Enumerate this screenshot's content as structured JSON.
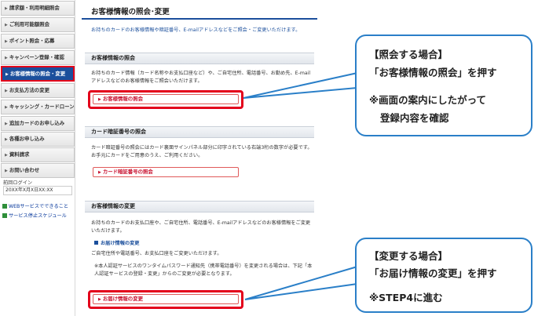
{
  "sidebar": {
    "items": [
      {
        "label": "請求額・利用明細照会"
      },
      {
        "label": "ご利用可能額照会"
      },
      {
        "label": "ポイント照会・応募"
      },
      {
        "label": "キャンペーン登録・確認"
      },
      {
        "label": "お客様情報の照会・変更"
      },
      {
        "label": "お支払方法の変更"
      },
      {
        "label": "キャッシング・カードローン"
      },
      {
        "label": "追加カードのお申し込み"
      },
      {
        "label": "各種お申し込み"
      },
      {
        "label": "資料請求"
      },
      {
        "label": "お問い合わせ"
      }
    ],
    "last_login_label": "前回ログイン",
    "last_login_value": "20XX年X月X日XX:XX",
    "links": [
      {
        "label": "WEBサービスでできること"
      },
      {
        "label": "サービス停止スケジュール"
      }
    ]
  },
  "main": {
    "title": "お客様情報の照会･変更",
    "intro": "お持ちのカードのお客様情報や暗証番号、E-mailアドレスなどをご照会・ご変更いただけます。",
    "sections": [
      {
        "heading": "お客様情報の照会",
        "text": "お持ちのカード情報（カード名称やお支払口座など）や、ご自宅住所、電話番号、お勤め先、E-mailアドレスなどのお客様情報をご照会いただけます。",
        "button": "お客様情報の照会"
      },
      {
        "heading": "カード暗証番号の照会",
        "text": "カード暗証番号の照会にはカード裏面サインパネル部分に印字されている右端3桁の数字が必要です。お手元にカードをご用意のうえ、ご利用ください。",
        "button": "カード暗証番号の照会"
      },
      {
        "heading": "お客様情報の変更",
        "text": "お持ちのカードのお支払口座や、ご自宅住所、電話番号、E-mailアドレスなどのお客様情報をご変更いただけます。",
        "subheading": "お届け情報の変更",
        "subtext": "ご自宅住所や電話番号、お支払口座をご変更いただけます。",
        "note": "※本人認証サービスのワンタイムパスワード通知先（携帯電話番号）を変更される場合は、下記「本人認証サービスの登録・変更」からのご変更が必要となります。",
        "button": "お届け情報の変更"
      }
    ]
  },
  "callouts": [
    {
      "lines": [
        "【照会する場合】",
        "「お客様情報の照会」を押す",
        "※画面の案内にしたがって",
        "登録内容を確認"
      ]
    },
    {
      "lines": [
        "【変更する場合】",
        "「お届け情報の変更」を押す",
        "※STEP4に進む"
      ]
    }
  ],
  "colors": {
    "accent": "#1b4f9c",
    "highlight": "#e3001b",
    "callout_border": "#2a7fc8",
    "link_green": "#2f8f3a"
  }
}
